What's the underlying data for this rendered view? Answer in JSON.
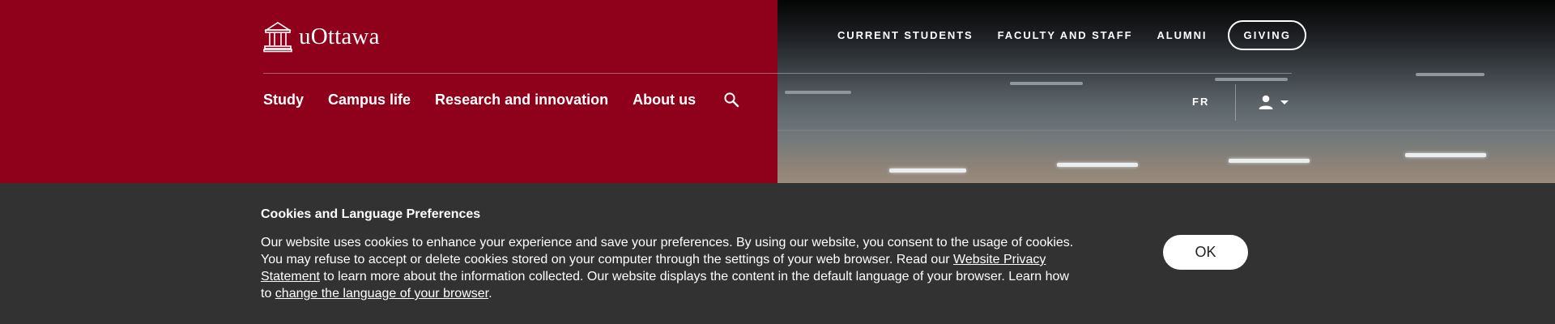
{
  "header": {
    "logo_text": "uOttawa",
    "utility_nav": [
      {
        "label": "CURRENT STUDENTS"
      },
      {
        "label": "FACULTY AND STAFF"
      },
      {
        "label": "ALUMNI"
      }
    ],
    "giving_label": "GIVING",
    "main_nav": [
      {
        "label": "Study"
      },
      {
        "label": "Campus life"
      },
      {
        "label": "Research and innovation"
      },
      {
        "label": "About us"
      }
    ],
    "search_icon": "search-icon",
    "lang_toggle": "FR",
    "user_icon": "user-icon",
    "colors": {
      "brand": "#8f001a",
      "banner": "#323232"
    }
  },
  "cookie_banner": {
    "title": "Cookies and Language Preferences",
    "text_part1": "Our website uses cookies to enhance your experience and save your preferences. By using our website, you consent to the usage of cookies. You may refuse to accept or delete cookies stored on your computer through the settings of your web browser. Read our ",
    "privacy_link": "Website Privacy Statement",
    "text_part2": " to learn more about the information collected. Our website displays the content in the default language of your browser. Learn how to ",
    "language_link": "change the language of your browser",
    "text_part3": ".",
    "ok_label": "OK"
  }
}
